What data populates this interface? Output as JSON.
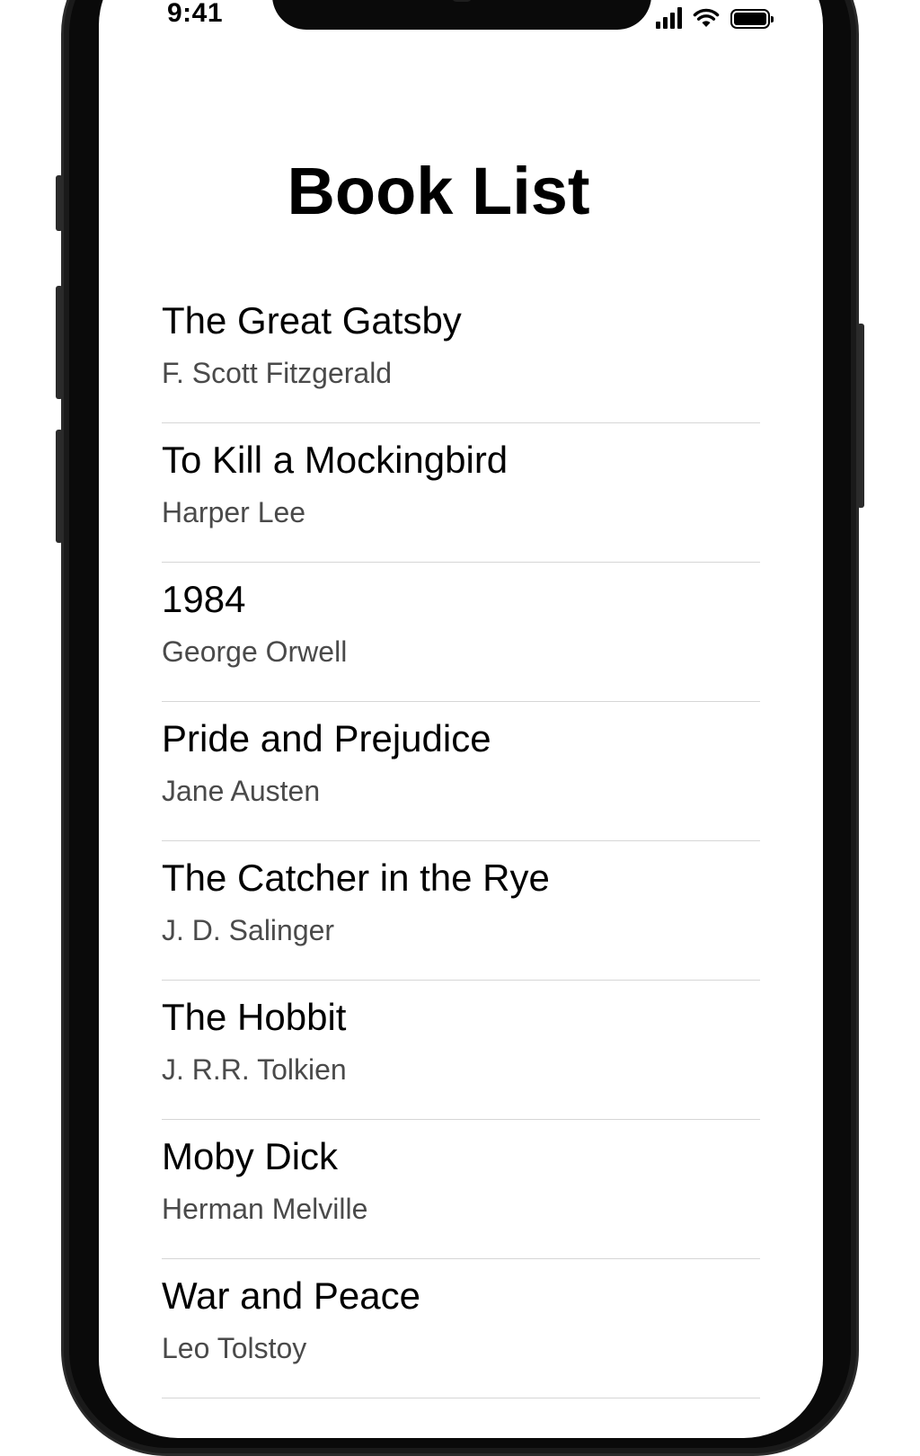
{
  "status_bar": {
    "time": "9:41",
    "icons": [
      "cellular-signal-icon",
      "wifi-icon",
      "battery-icon"
    ]
  },
  "header": {
    "title": "Book List"
  },
  "books": [
    {
      "title": "The Great Gatsby",
      "author": "F. Scott Fitzgerald"
    },
    {
      "title": "To Kill a Mockingbird",
      "author": "Harper Lee"
    },
    {
      "title": "1984",
      "author": "George Orwell"
    },
    {
      "title": "Pride and Prejudice",
      "author": "Jane Austen"
    },
    {
      "title": "The Catcher in the Rye",
      "author": "J. D. Salinger"
    },
    {
      "title": "The Hobbit",
      "author": "J. R.R. Tolkien"
    },
    {
      "title": "Moby Dick",
      "author": "Herman Melville"
    },
    {
      "title": "War and Peace",
      "author": "Leo Tolstoy"
    }
  ],
  "colors": {
    "background": "#ffffff",
    "title_text": "#000000",
    "author_text": "#4a4a4a",
    "separator": "#d6d6d6",
    "phone_frame": "#0a0a0a"
  }
}
